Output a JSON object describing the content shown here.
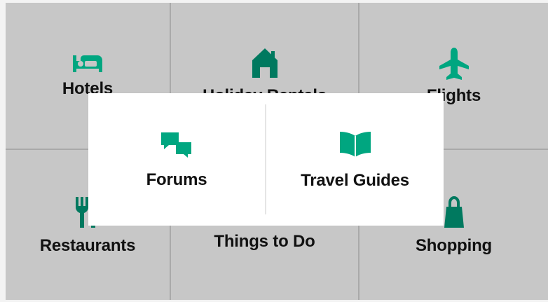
{
  "colors": {
    "accent": "#00a680",
    "icon_dark": "#00795f",
    "tile_bg": "#c7c7c7",
    "overlay_bg": "#ffffff",
    "text": "#111111"
  },
  "categories": [
    {
      "label": "Hotels",
      "icon": "bed-icon"
    },
    {
      "label": "Holiday Rentals",
      "icon": "house-icon"
    },
    {
      "label": "Flights",
      "icon": "airplane-icon"
    },
    {
      "label": "Restaurants",
      "icon": "cutlery-icon"
    },
    {
      "label": "Things to Do",
      "icon": "ticket-icon"
    },
    {
      "label": "Shopping",
      "icon": "shopping-bag-icon"
    }
  ],
  "more_menu": {
    "items": [
      {
        "label": "Forums",
        "icon": "chat-bubbles-icon"
      },
      {
        "label": "Travel Guides",
        "icon": "open-book-icon"
      }
    ]
  }
}
